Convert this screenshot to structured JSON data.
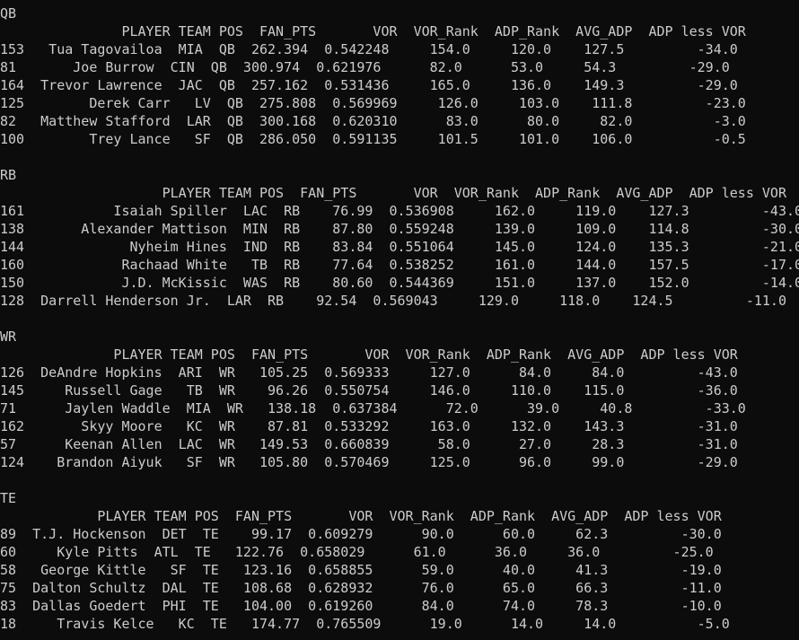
{
  "terminal": {
    "lines": [
      "QB",
      "               PLAYER TEAM POS  FAN_PTS       VOR  VOR_Rank  ADP_Rank  AVG_ADP  ADP less VOR",
      "153   Tua Tagovailoa  MIA  QB  262.394  0.542248     154.0     120.0    127.5         -34.0",
      "81       Joe Burrow  CIN  QB  300.974  0.621976      82.0      53.0     54.3         -29.0",
      "164  Trevor Lawrence  JAC  QB  257.162  0.531436     165.0     136.0    149.3         -29.0",
      "125        Derek Carr   LV  QB  275.808  0.569969     126.0     103.0    111.8         -23.0",
      "82   Matthew Stafford  LAR  QB  300.168  0.620310      83.0      80.0     82.0          -3.0",
      "100        Trey Lance   SF  QB  286.050  0.591135     101.5     101.0    106.0          -0.5",
      "",
      "RB",
      "                    PLAYER TEAM POS  FAN_PTS       VOR  VOR_Rank  ADP_Rank  AVG_ADP  ADP less VOR",
      "161           Isaiah Spiller  LAC  RB    76.99  0.536908     162.0     119.0    127.3         -43.0",
      "138       Alexander Mattison  MIN  RB    87.80  0.559248     139.0     109.0    114.8         -30.0",
      "144             Nyheim Hines  IND  RB    83.84  0.551064     145.0     124.0    135.3         -21.0",
      "160            Rachaad White   TB  RB    77.64  0.538252     161.0     144.0    157.5         -17.0",
      "150            J.D. McKissic  WAS  RB    80.60  0.544369     151.0     137.0    152.0         -14.0",
      "128  Darrell Henderson Jr.  LAR  RB    92.54  0.569043     129.0     118.0    124.5         -11.0",
      "",
      "WR",
      "              PLAYER TEAM POS  FAN_PTS       VOR  VOR_Rank  ADP_Rank  AVG_ADP  ADP less VOR",
      "126  DeAndre Hopkins  ARI  WR   105.25  0.569333     127.0      84.0     84.0         -43.0",
      "145     Russell Gage   TB  WR    96.26  0.550754     146.0     110.0    115.0         -36.0",
      "71      Jaylen Waddle  MIA  WR   138.18  0.637384      72.0      39.0     40.8         -33.0",
      "162       Skyy Moore   KC  WR    87.81  0.533292     163.0     132.0    143.3         -31.0",
      "57      Keenan Allen  LAC  WR   149.53  0.660839      58.0      27.0     28.3         -31.0",
      "124    Brandon Aiyuk   SF  WR   105.80  0.570469     125.0      96.0     99.0         -29.0",
      "",
      "TE",
      "            PLAYER TEAM POS  FAN_PTS       VOR  VOR_Rank  ADP_Rank  AVG_ADP  ADP less VOR",
      "89  T.J. Hockenson  DET  TE    99.17  0.609279      90.0      60.0     62.3         -30.0",
      "60     Kyle Pitts  ATL  TE   122.76  0.658029      61.0      36.0     36.0         -25.0",
      "58   George Kittle   SF  TE   123.16  0.658855      59.0      40.0     41.3         -19.0",
      "75  Dalton Schultz  DAL  TE   108.68  0.628932      76.0      65.0     66.3         -11.0",
      "83  Dallas Goedert  PHI  TE   104.00  0.619260      84.0      74.0     78.3         -10.0",
      "18     Travis Kelce   KC  TE   174.77  0.765509      19.0      14.0     14.0          -5.0"
    ]
  }
}
